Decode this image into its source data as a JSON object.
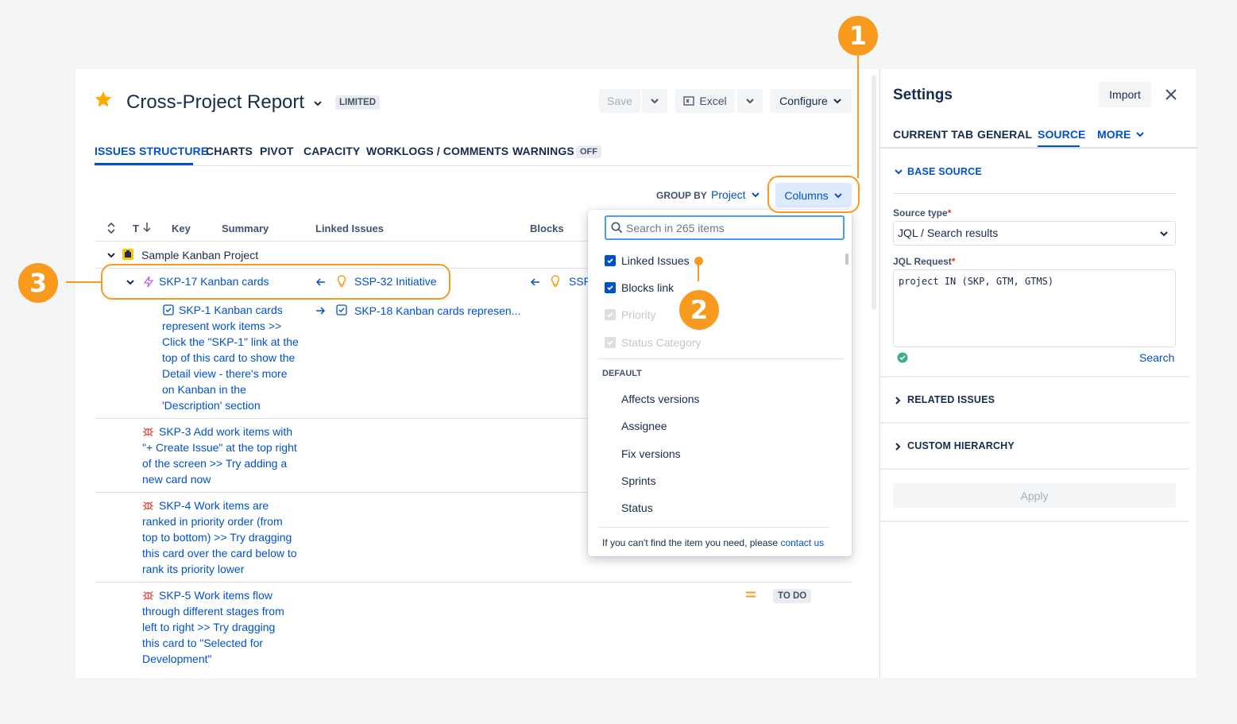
{
  "report": {
    "title": "Cross-Project Report",
    "badge": "LIMITED",
    "save_label": "Save",
    "excel_label": "Excel",
    "configure_label": "Configure"
  },
  "tabs": [
    "ISSUES STRUCTURE",
    "CHARTS",
    "PIVOT",
    "CAPACITY",
    "WORKLOGS / COMMENTS",
    "WARNINGS"
  ],
  "warnings_badge": "OFF",
  "groupby": {
    "label": "GROUP BY",
    "value": "Project",
    "columns_label": "Columns"
  },
  "table": {
    "headers": {
      "type": "T",
      "key": "Key",
      "summary": "Summary",
      "linked": "Linked Issues",
      "blocks": "Blocks"
    },
    "group": "Sample Kanban Project",
    "rows": [
      {
        "text": "SKP-17 Kanban cards",
        "linked": "SSP-32 Initiative",
        "blocks": "SSP"
      },
      {
        "lines": [
          "SKP-1 Kanban cards",
          "represent work items >>",
          "Click the \"SKP-1\" link at the",
          "top of this card to show the",
          "Detail view - there's more",
          "on Kanban in the",
          "'Description' section"
        ],
        "linked": "SKP-18 Kanban cards represen..."
      },
      {
        "lines": [
          "SKP-3 Add work items with",
          "\"+ Create Issue\" at the top right",
          "of the screen >> Try adding a",
          "new card now"
        ]
      },
      {
        "lines": [
          "SKP-4 Work items are",
          "ranked in priority order (from",
          "top to bottom) >> Try dragging",
          "this card over the card below to",
          "rank its priority lower"
        ]
      },
      {
        "lines": [
          "SKP-5 Work items flow",
          "through different stages from",
          "left to right >> Try dragging",
          "this card to \"Selected for",
          "Development\""
        ],
        "status": "TO DO"
      }
    ]
  },
  "dropdown": {
    "search_placeholder": "Search in 265 items",
    "checked": [
      "Linked Issues",
      "Blocks link"
    ],
    "disabled": [
      "Priority",
      "Status Category"
    ],
    "section": "DEFAULT",
    "items": [
      "Affects versions",
      "Assignee",
      "Fix versions",
      "Sprints",
      "Status"
    ],
    "footer_text": "If you can't find the item you need, please",
    "footer_link": "contact us"
  },
  "settings": {
    "title": "Settings",
    "import_label": "Import",
    "tabs": [
      "CURRENT TAB",
      "GENERAL",
      "SOURCE",
      "MORE"
    ],
    "base_source": "BASE SOURCE",
    "source_type_label": "Source type",
    "source_type_value": "JQL / Search results",
    "jql_label": "JQL Request",
    "jql_value": "project IN (SKP, GTM, GTMS)",
    "search_label": "Search",
    "related": "RELATED ISSUES",
    "hierarchy": "CUSTOM HIERARCHY",
    "apply_label": "Apply",
    "required_mark": "*"
  },
  "callouts": [
    "1",
    "2",
    "3"
  ],
  "colors": {
    "accent": "#0052cc",
    "callout": "#f79a1e",
    "star": "#ffab00"
  }
}
